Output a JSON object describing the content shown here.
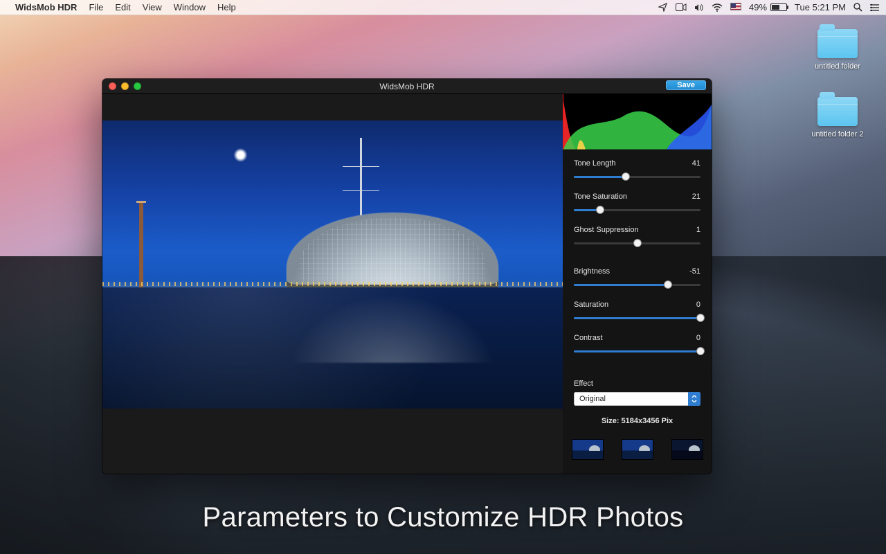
{
  "menubar": {
    "app_name": "WidsMob HDR",
    "items": [
      "File",
      "Edit",
      "View",
      "Window",
      "Help"
    ],
    "battery_percent": "49%",
    "clock": "Tue 5:21 PM"
  },
  "desktop": {
    "folders": [
      {
        "name": "untitled folder"
      },
      {
        "name": "untitled folder 2"
      }
    ]
  },
  "window": {
    "title": "WidsMob HDR",
    "save_label": "Save"
  },
  "panel": {
    "sliders": [
      {
        "label": "Tone Length",
        "value": 41,
        "min": 0,
        "max": 100,
        "pos": 0.41
      },
      {
        "label": "Tone Saturation",
        "value": 21,
        "min": 0,
        "max": 100,
        "pos": 0.21
      },
      {
        "label": "Ghost Suppression",
        "value": 1,
        "min": 0,
        "max": 2,
        "pos": 0.5
      },
      {
        "label": "Brightness",
        "value": -51,
        "min": -200,
        "max": 0,
        "pos": 0.745
      },
      {
        "label": "Saturation",
        "value": 0,
        "min": -100,
        "max": 0,
        "pos": 1.0
      },
      {
        "label": "Contrast",
        "value": 0,
        "min": -100,
        "max": 0,
        "pos": 1.0
      }
    ],
    "effect_label": "Effect",
    "effect_value": "Original",
    "size_label": "Size: 5184x3456 Pix"
  },
  "caption": "Parameters to Customize HDR Photos"
}
